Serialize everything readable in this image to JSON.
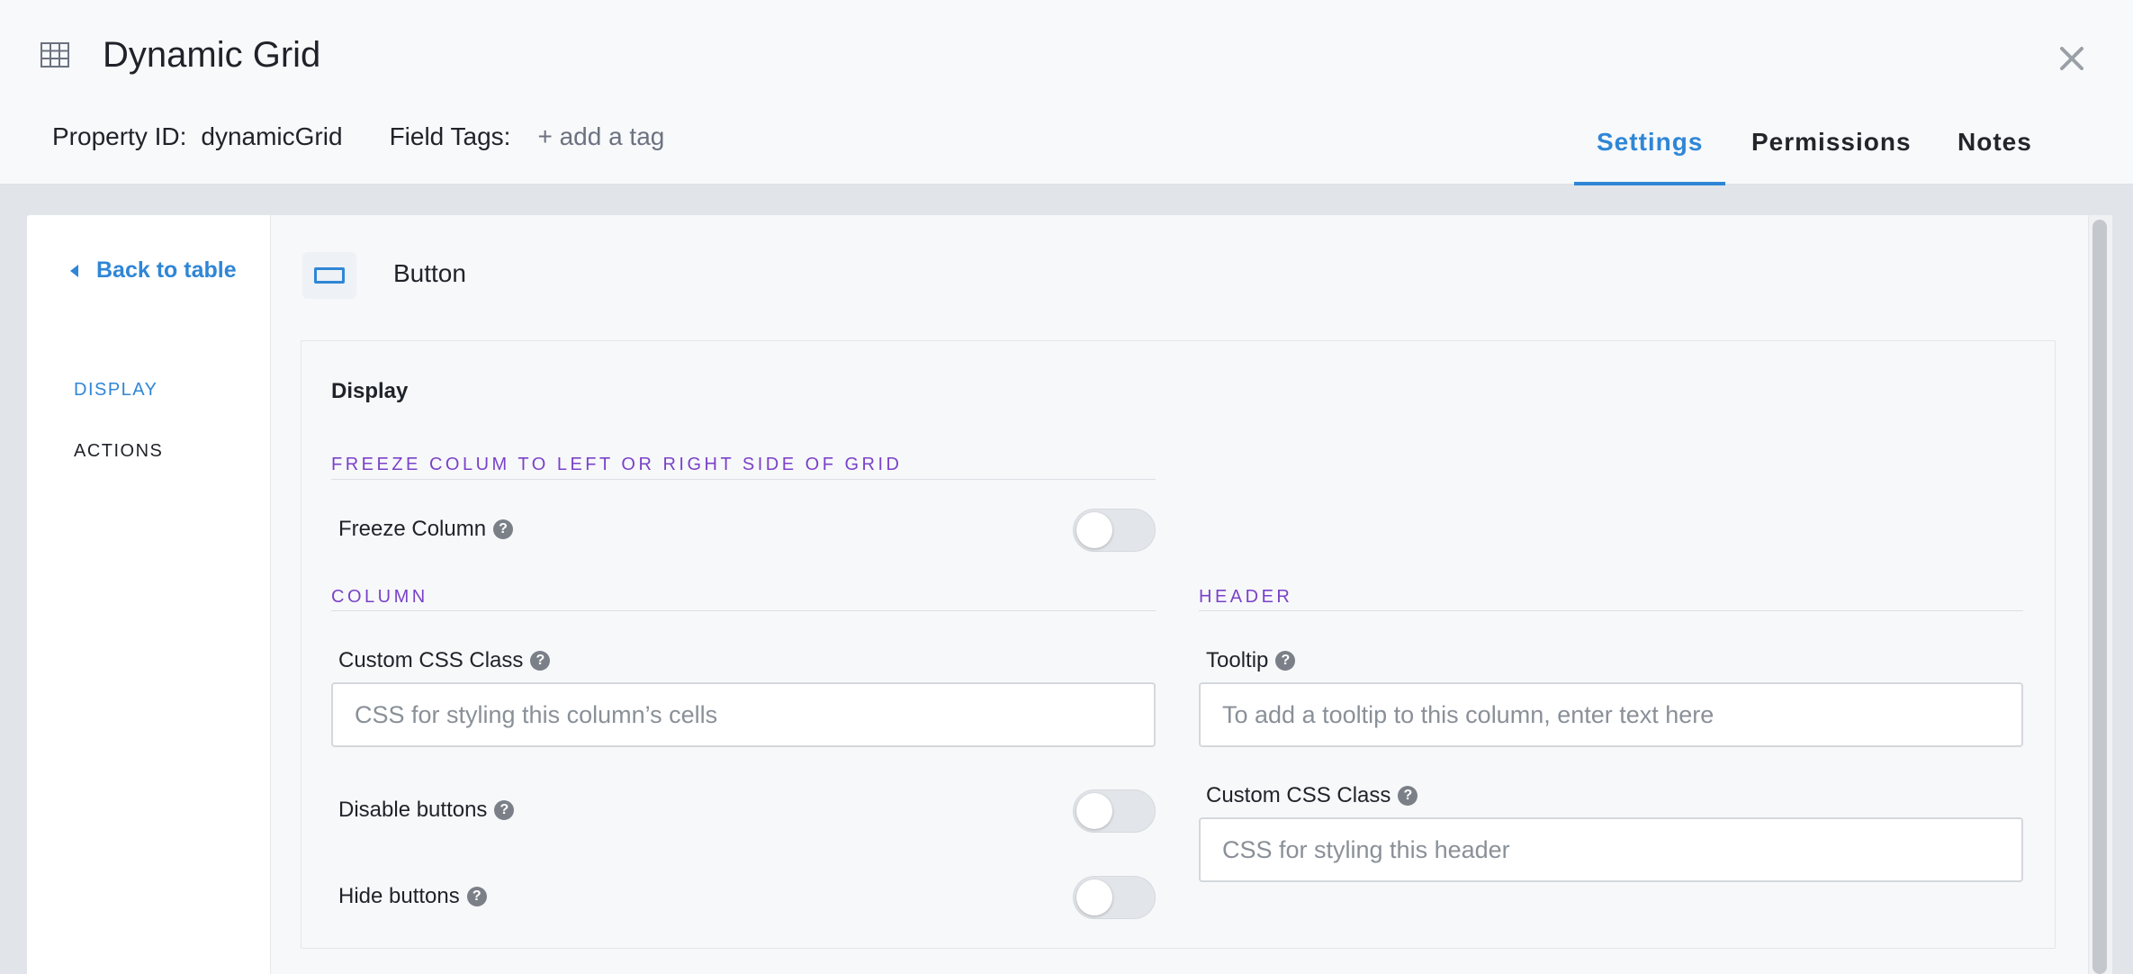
{
  "app": {
    "title": "Dynamic Grid",
    "icon": "table-grid-icon",
    "close_icon": "close-icon"
  },
  "property": {
    "id_label": "Property ID:",
    "id_value": "dynamicGrid",
    "tags_label": "Field Tags:",
    "add_tag": "+ add a tag"
  },
  "tabs": [
    {
      "label": "Settings",
      "active": true
    },
    {
      "label": "Permissions",
      "active": false
    },
    {
      "label": "Notes",
      "active": false
    }
  ],
  "sidebar": {
    "back_label": "Back to table",
    "items": [
      {
        "label": "DISPLAY",
        "active": true
      },
      {
        "label": "ACTIONS",
        "active": false
      }
    ]
  },
  "main": {
    "component_title": "Button",
    "component_icon": "button-icon",
    "panel_title": "Display",
    "freeze_section": {
      "heading": "FREEZE COLUM TO LEFT OR RIGHT SIDE OF GRID",
      "freeze_label": "Freeze Column",
      "freeze_on": false
    },
    "column_section": {
      "heading": "COLUMN",
      "css_label": "Custom CSS Class",
      "css_placeholder": "CSS for styling this column’s cells",
      "css_value": "",
      "disable_label": "Disable buttons",
      "disable_on": false,
      "hide_label": "Hide buttons",
      "hide_on": false
    },
    "header_section": {
      "heading": "HEADER",
      "tooltip_label": "Tooltip",
      "tooltip_placeholder": "To add a tooltip to this column, enter text here",
      "tooltip_value": "",
      "css_label": "Custom CSS Class",
      "css_placeholder": "CSS for styling this header",
      "css_value": ""
    }
  },
  "colors": {
    "accent": "#2f86d6",
    "section_heading": "#7a42c8",
    "toggle_off": "#e2e5e9"
  }
}
